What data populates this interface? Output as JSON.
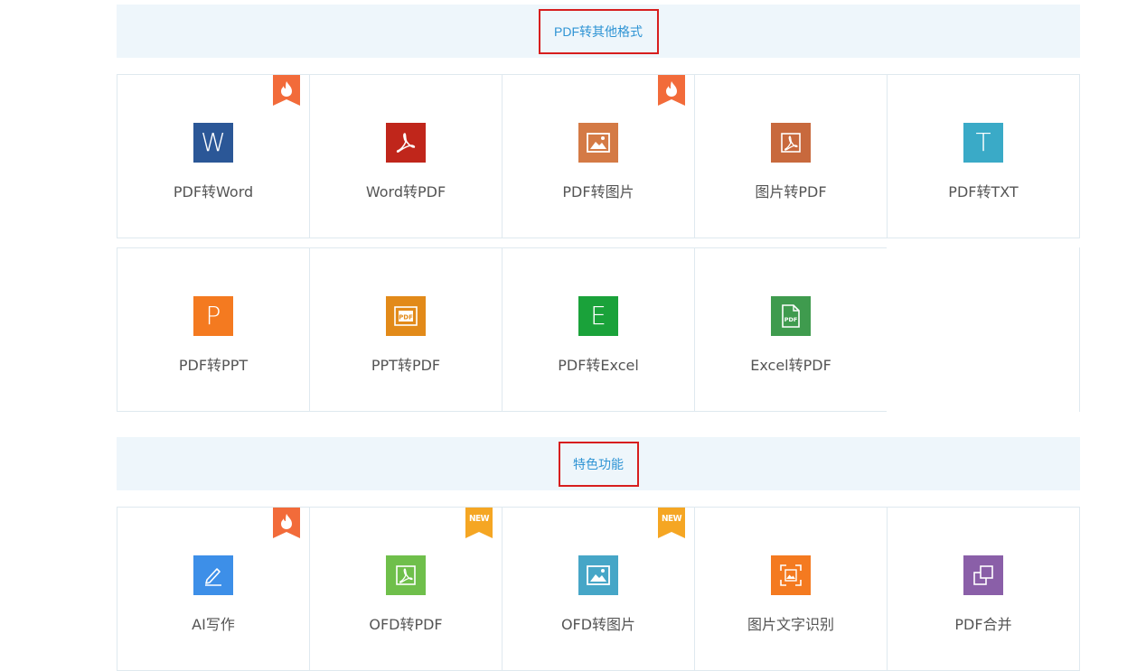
{
  "sections": {
    "pdf_convert": {
      "title": "PDF转其他格式"
    },
    "features": {
      "title": "特色功能"
    }
  },
  "tools_row1": [
    {
      "label": "PDF转Word",
      "icon": "word-icon",
      "icon_letter": "W",
      "color": "#2b5797",
      "badge": "hot"
    },
    {
      "label": "Word转PDF",
      "icon": "acrobat-icon",
      "color": "#c0261b",
      "badge": null
    },
    {
      "label": "PDF转图片",
      "icon": "image-icon",
      "color": "#d47a45",
      "badge": "hot"
    },
    {
      "label": "图片转PDF",
      "icon": "pdf-doc-icon",
      "color": "#c8693d",
      "badge": null
    },
    {
      "label": "PDF转TXT",
      "icon": "text-icon",
      "icon_letter": "T",
      "color": "#3aaac7",
      "badge": null
    }
  ],
  "tools_row2": [
    {
      "label": "PDF转PPT",
      "icon": "powerpoint-icon",
      "icon_letter": "P",
      "color": "#f47a20",
      "badge": null
    },
    {
      "label": "PPT转PDF",
      "icon": "ppt-pdf-icon",
      "color": "#e28a19",
      "badge": null
    },
    {
      "label": "PDF转Excel",
      "icon": "excel-icon",
      "icon_letter": "E",
      "color": "#1aa23a",
      "badge": null
    },
    {
      "label": "Excel转PDF",
      "icon": "excel-pdf-icon",
      "color": "#3f9b4e",
      "badge": null
    }
  ],
  "tools_row3": [
    {
      "label": "AI写作",
      "icon": "pen-icon",
      "color": "#3d8fe8",
      "badge": "hot"
    },
    {
      "label": "OFD转PDF",
      "icon": "ofd-pdf-icon",
      "color": "#6fbf4b",
      "badge": "new"
    },
    {
      "label": "OFD转图片",
      "icon": "ofd-image-icon",
      "color": "#46a6c7",
      "badge": "new"
    },
    {
      "label": "图片文字识别",
      "icon": "ocr-icon",
      "color": "#f47a20",
      "badge": null
    },
    {
      "label": "PDF合并",
      "icon": "merge-icon",
      "color": "#8a5fa8",
      "badge": null
    }
  ],
  "badges": {
    "new_text": "NEW",
    "hot_color": "#f26b3a",
    "new_color": "#f5a623"
  }
}
